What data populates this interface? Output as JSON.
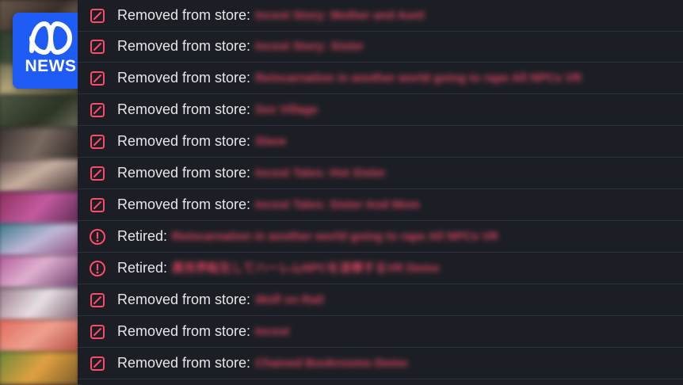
{
  "brand": {
    "abc_logo_icon": "abc-lissajous-icon",
    "news_label": "NEWS",
    "color": "#1f5cf5"
  },
  "colors": {
    "background": "#1b1e24",
    "accent": "#ff4a6a",
    "text": "#e6e7ea"
  },
  "rows": [
    {
      "status": "Removed from store:",
      "title": "Incest Story: Mother and Aunt",
      "icon": "removed-slash-icon"
    },
    {
      "status": "Removed from store:",
      "title": "Incest Story: Sister",
      "icon": "removed-slash-icon"
    },
    {
      "status": "Removed from store:",
      "title": "Reincarnation in another world going to rape All NPCs VR",
      "icon": "removed-slash-icon"
    },
    {
      "status": "Removed from store:",
      "title": "Sex Village",
      "icon": "removed-slash-icon"
    },
    {
      "status": "Removed from store:",
      "title": "Slave",
      "icon": "removed-slash-icon"
    },
    {
      "status": "Removed from store:",
      "title": "Incest Tales: Hot Sister",
      "icon": "removed-slash-icon"
    },
    {
      "status": "Removed from store:",
      "title": "Incest Tales: Sister And Mom",
      "icon": "removed-slash-icon"
    },
    {
      "status": "Retired:",
      "title": "Reincarnation in another world going to rape All NPCs VR",
      "icon": "retired-alert-icon"
    },
    {
      "status": "Retired:",
      "title": "異世界転生してハーレムNPCを凌辱するVR Demo",
      "icon": "retired-alert-icon"
    },
    {
      "status": "Removed from store:",
      "title": "Wolf on Rail",
      "icon": "removed-slash-icon"
    },
    {
      "status": "Removed from store:",
      "title": "Incest",
      "icon": "removed-slash-icon"
    },
    {
      "status": "Removed from store:",
      "title": "Chained Bookrooms Demo",
      "icon": "removed-slash-icon"
    }
  ]
}
